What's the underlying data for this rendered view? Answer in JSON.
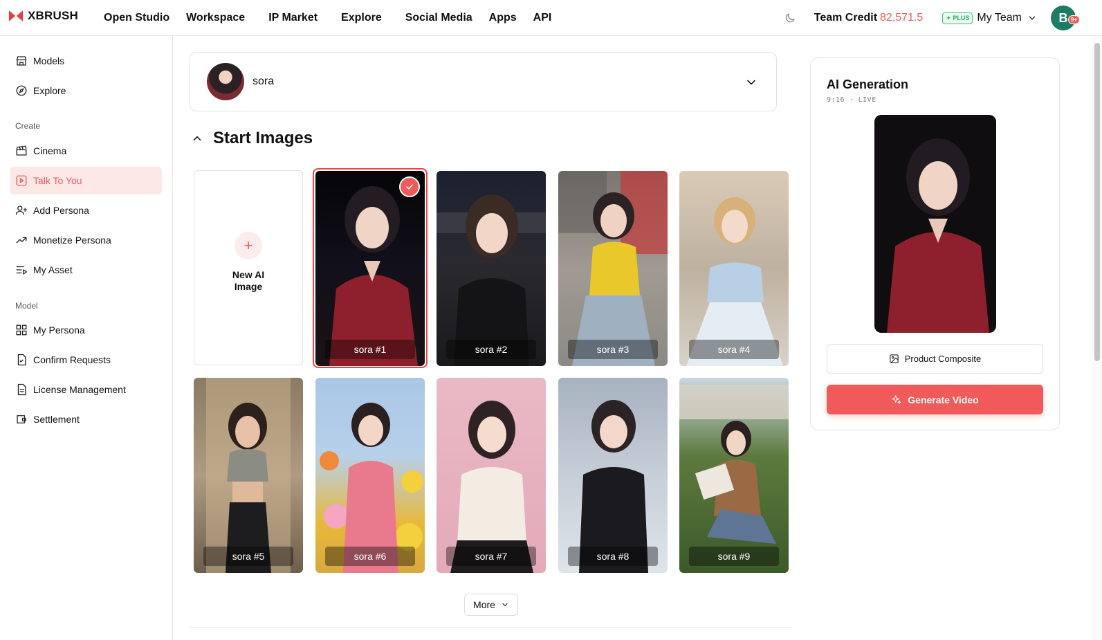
{
  "app": {
    "brand": "XBRUSH"
  },
  "nav": {
    "items": [
      "Open Studio",
      "Workspace",
      "IP Market",
      "Explore",
      "Social Media",
      "Apps",
      "API"
    ]
  },
  "header": {
    "credit_label": "Team Credit",
    "credit_value": "82,571.5",
    "plan_badge": "PLUS",
    "team_label": "My Team",
    "avatar_letter": "B",
    "notif_badge": "9+"
  },
  "sidebar": {
    "top": [
      {
        "label": "Models",
        "icon": "store-icon"
      },
      {
        "label": "Explore",
        "icon": "compass-icon"
      }
    ],
    "section_create": "Create",
    "create": [
      {
        "label": "Cinema",
        "icon": "clapperboard-icon"
      },
      {
        "label": "Talk To You",
        "icon": "play-square-icon",
        "active": true
      },
      {
        "label": "Add Persona",
        "icon": "user-plus-icon"
      },
      {
        "label": "Monetize Persona",
        "icon": "trending-up-icon"
      },
      {
        "label": "My Asset",
        "icon": "list-video-icon"
      }
    ],
    "section_model": "Model",
    "model": [
      {
        "label": "My Persona",
        "icon": "grid-icon"
      },
      {
        "label": "Confirm Requests",
        "icon": "file-check-icon"
      },
      {
        "label": "License Management",
        "icon": "file-text-icon"
      },
      {
        "label": "Settlement",
        "icon": "wallet-icon"
      }
    ]
  },
  "persona_select": {
    "name": "sora"
  },
  "start_images": {
    "title": "Start Images",
    "new_label": "New AI Image",
    "items": [
      {
        "caption": "sora #1",
        "selected": true
      },
      {
        "caption": "sora #2"
      },
      {
        "caption": "sora #3"
      },
      {
        "caption": "sora #4"
      },
      {
        "caption": "sora #5"
      },
      {
        "caption": "sora #6"
      },
      {
        "caption": "sora #7"
      },
      {
        "caption": "sora #8"
      },
      {
        "caption": "sora #9"
      }
    ],
    "more_label": "More"
  },
  "ai_panel": {
    "title": "AI Generation",
    "subtitle": "9:16 · LIVE",
    "product_composite_label": "Product Composite",
    "generate_label": "Generate Video"
  },
  "colors": {
    "accent": "#f15a5a",
    "active_bg": "#fde8e8",
    "plus_green": "#2fa865"
  }
}
